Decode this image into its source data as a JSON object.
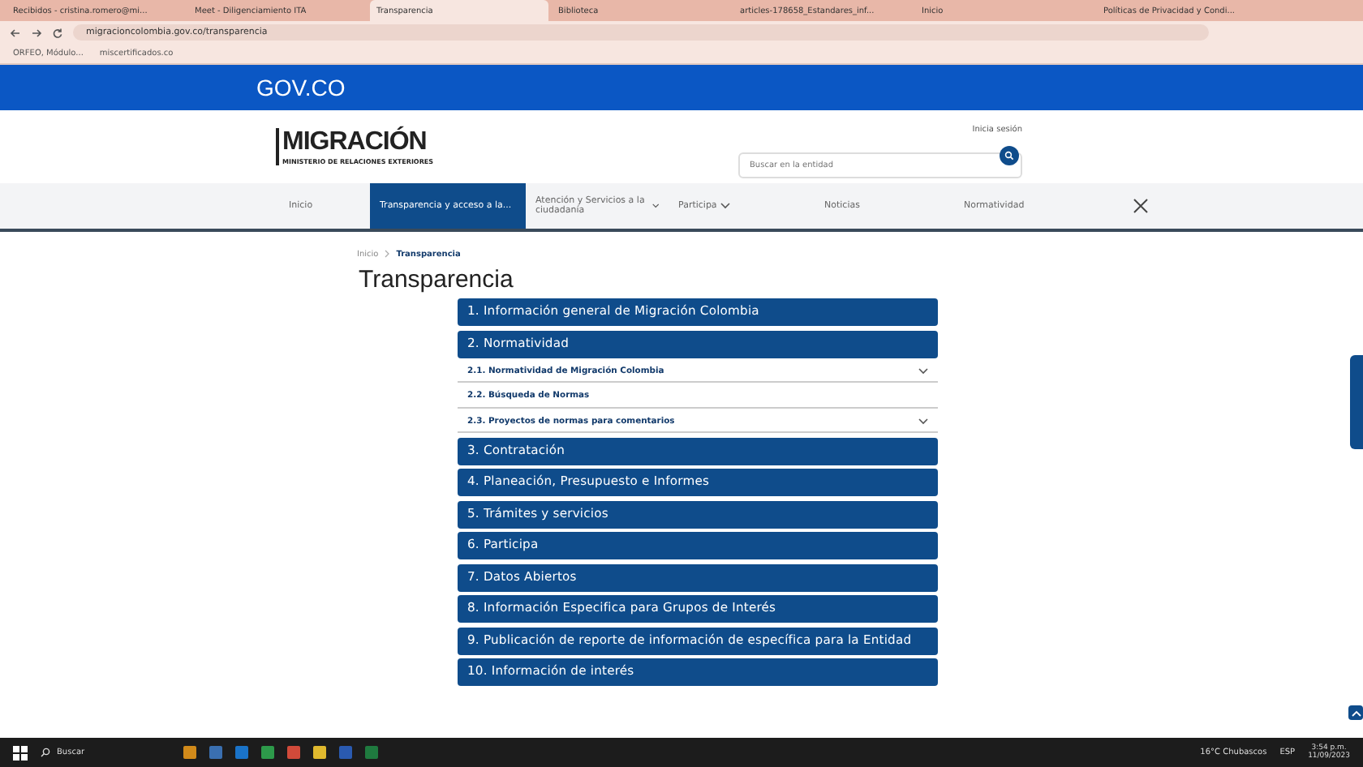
{
  "browser": {
    "tabs": [
      {
        "label": "Recibidos - cristina.romero@mi...",
        "selected": false
      },
      {
        "label": "Meet - Diligenciamiento ITA",
        "selected": false
      },
      {
        "label": "Transparencia",
        "selected": true
      },
      {
        "label": "Biblioteca",
        "selected": false
      },
      {
        "label": "articles-178658_Estandares_inf...",
        "selected": false
      },
      {
        "label": "Inicio",
        "selected": false
      },
      {
        "label": "Políticas de Privacidad y Condi...",
        "selected": false
      }
    ],
    "address": "migracioncolombia.gov.co/transparencia",
    "bookmarks": [
      "ORFEO, Módulo...",
      "miscertificados.co"
    ]
  },
  "gov_bar": {
    "logo": "GOV.CO"
  },
  "header": {
    "logo": "MIGRACIÓN",
    "logo_subtitle": "MINISTERIO DE RELACIONES EXTERIORES",
    "login": "Inicia sesión",
    "search": {
      "placeholder": "Buscar en la entidad"
    }
  },
  "nav": {
    "items": [
      {
        "label": "Inicio",
        "selected": false,
        "dropdown": false
      },
      {
        "label": "Transparencia y acceso a la...",
        "selected": true,
        "dropdown": false
      },
      {
        "label": "Atención y Servicios a la ciudadanía",
        "selected": false,
        "dropdown": true
      },
      {
        "label": "Participa",
        "selected": false,
        "dropdown": true
      },
      {
        "label": "Noticias",
        "selected": false,
        "dropdown": false
      },
      {
        "label": "Normatividad",
        "selected": false,
        "dropdown": false
      }
    ]
  },
  "breadcrumb": [
    "Inicio",
    "Transparencia"
  ],
  "title": "Transparencia",
  "accordion": [
    {
      "kind": "section",
      "label": "1. Información general de Migración Colombia"
    },
    {
      "kind": "section",
      "label": "2. Normatividad"
    },
    {
      "kind": "subsection",
      "label": "2.1. Normatividad de Migración Colombia",
      "expandable": true
    },
    {
      "kind": "subsection",
      "label": "2.2. Búsqueda de Normas",
      "expandable": false
    },
    {
      "kind": "subsection",
      "label": "2.3. Proyectos de normas para comentarios",
      "expandable": true
    },
    {
      "kind": "section",
      "label": "3. Contratación"
    },
    {
      "kind": "section",
      "label": "4. Planeación, Presupuesto e Informes"
    },
    {
      "kind": "section",
      "label": "5. Trámites y servicios"
    },
    {
      "kind": "section",
      "label": "6. Participa"
    },
    {
      "kind": "section",
      "label": "7. Datos Abiertos"
    },
    {
      "kind": "section",
      "label": "8. Información Especifica para Grupos de Interés"
    },
    {
      "kind": "section",
      "label": "9. Publicación de reporte de información de específica para la Entidad"
    },
    {
      "kind": "section",
      "label": "10. Información de interés"
    }
  ],
  "taskbar": {
    "search": "Buscar",
    "weather": "16°C  Chubascos",
    "language": "ESP",
    "time": "3:54 p.m.",
    "date": "11/09/2023"
  }
}
